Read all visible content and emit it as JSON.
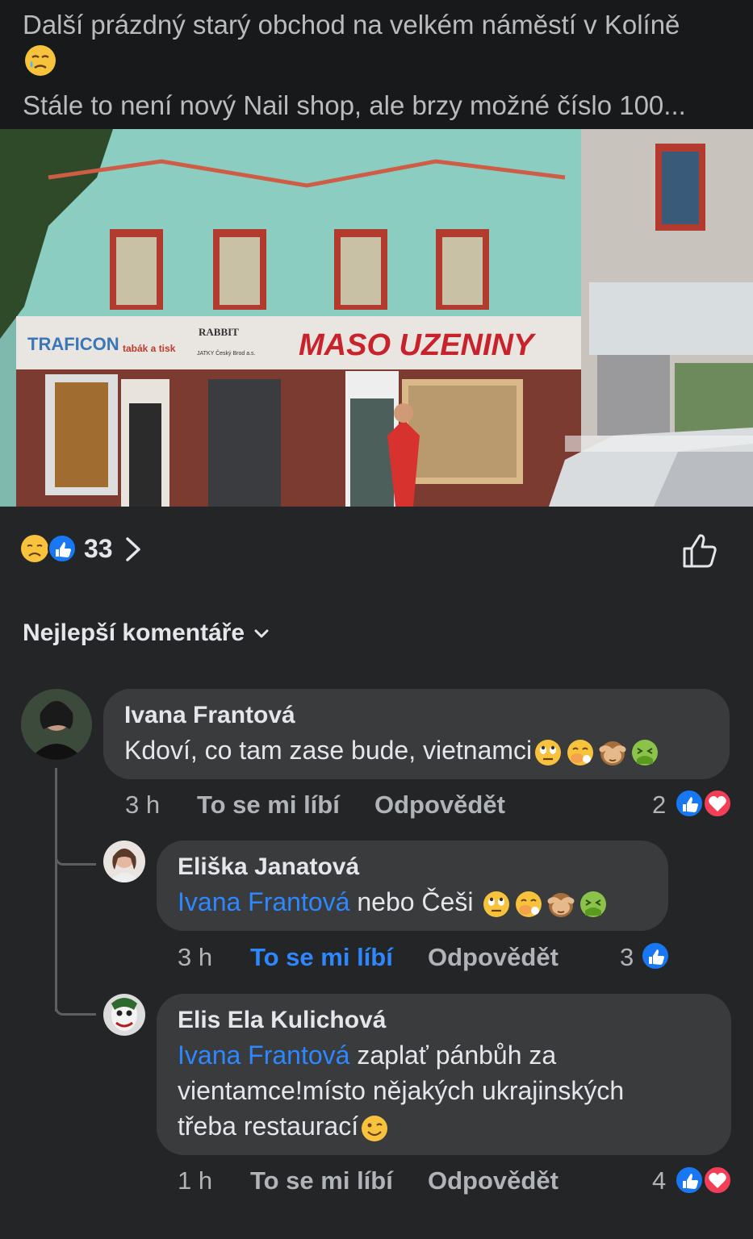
{
  "post": {
    "line1": "Další prázdný starý obchod na velkém náměstí v Kolíně",
    "line2": "Stále to není nový Nail shop, ale brzy možné číslo 100..."
  },
  "photo": {
    "sign_traficon": "TRAFICON",
    "sign_tabak": "tabák a tisk",
    "sign_rabbit": "RABBIT",
    "sign_jatky": "JATKY Český Brod a.s.",
    "sign_maso": "MASO UZENINY"
  },
  "reactions": {
    "count": "33",
    "icons": [
      "sad-emoji",
      "like"
    ]
  },
  "sort_label": "Nejlepší komentáře",
  "comments": [
    {
      "author": "Ivana Frantová",
      "text": "Kdoví, co tam zase bude, vietnamci",
      "emojis": [
        "eye-roll",
        "cough",
        "see-no-evil-monkey",
        "vomit"
      ],
      "time": "3 h",
      "like_label": "To se mi líbí",
      "reply_label": "Odpovědět",
      "reaction_count": "2",
      "reaction_icons": [
        "like",
        "love"
      ]
    },
    {
      "author": "Eliška Janatová",
      "mention": "Ivana Frantová",
      "text": " nebo Češi ",
      "emojis": [
        "eye-roll",
        "cough",
        "see-no-evil-monkey",
        "vomit"
      ],
      "time": "3 h",
      "like_label": "To se mi líbí",
      "like_active": true,
      "reply_label": "Odpovědět",
      "reaction_count": "3",
      "reaction_icons": [
        "like"
      ]
    },
    {
      "author": "Elis Ela Kulichová",
      "mention": "Ivana Frantová",
      "text_line1": " zaplať pánbůh za",
      "text_line2": "vientamce!místo nějakých ukrajinských",
      "text_line3": "třeba restaurací",
      "emojis": [
        "wink"
      ],
      "time": "1 h",
      "like_label": "To se mi líbí",
      "reply_label": "Odpovědět",
      "reaction_count": "4",
      "reaction_icons": [
        "like",
        "love"
      ]
    }
  ],
  "colors": {
    "background": "#242526",
    "bubble": "#3a3b3c",
    "accent": "#2d88ff",
    "love": "#f33e58"
  }
}
